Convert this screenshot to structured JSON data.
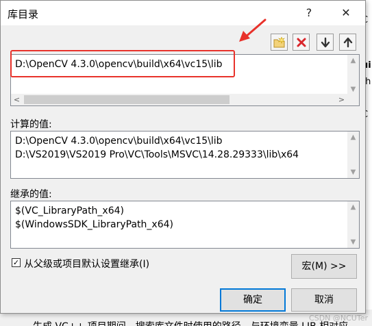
{
  "dialog": {
    "title": "库目录",
    "help_label": "?",
    "close_label": "✕"
  },
  "toolbar": {
    "icons": [
      "new-folder-icon",
      "delete-icon",
      "move-down-icon",
      "move-up-icon"
    ]
  },
  "editor": {
    "lines": [
      "D:\\OpenCV 4.3.0\\opencv\\build\\x64\\vc15\\lib"
    ],
    "highlight_color": "#e8312a"
  },
  "evaluated": {
    "label": "计算的值:",
    "lines": [
      "D:\\OpenCV 4.3.0\\opencv\\build\\x64\\vc15\\lib",
      "D:\\VS2019\\VS2019 Pro\\VC\\Tools\\MSVC\\14.28.29333\\lib\\x64"
    ]
  },
  "inherited": {
    "label": "继承的值:",
    "lines": [
      "$(VC_LibraryPath_x64)",
      "$(WindowsSDK_LibraryPath_x64)"
    ]
  },
  "inherit_checkbox": {
    "label": "从父级或项目默认设置继承(I)",
    "checked": true
  },
  "buttons": {
    "macros": "宏(M) >>",
    "ok": "确定",
    "cancel": "取消"
  },
  "background": {
    "bottom_text": "生成 VC++ 项目期间，搜索库文件时使用的路径。与环境变量 LIB 相对应",
    "watermark": "CSDN @NCUTer",
    "right_peek": [
      "C",
      "ui",
      "ui",
      "th",
      "C"
    ]
  },
  "colors": {
    "accent": "#0078d7",
    "annotation": "#e8312a"
  }
}
